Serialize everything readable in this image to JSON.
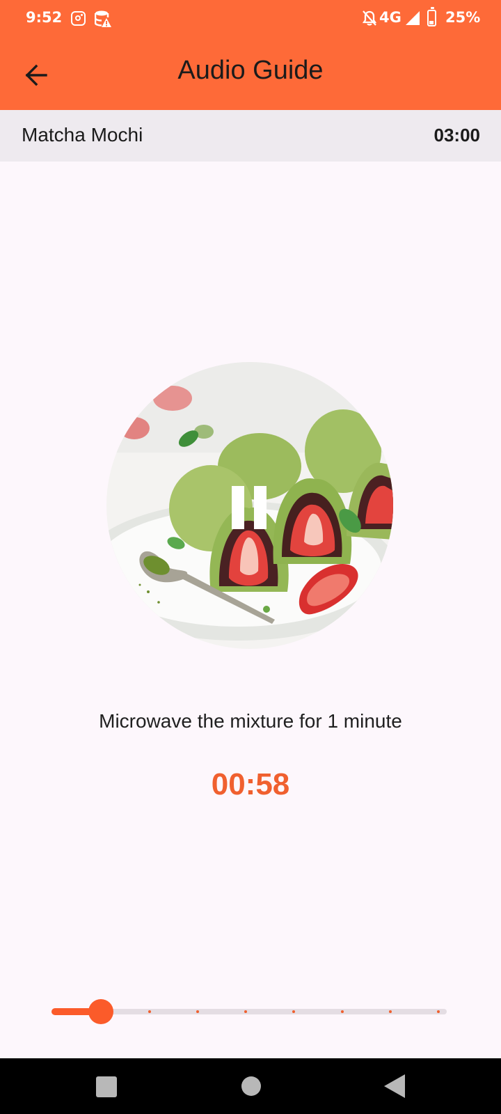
{
  "status_bar": {
    "time": "9:52",
    "network": "4G",
    "battery": "25%",
    "icons": [
      "instagram-icon",
      "database-warning-icon",
      "bell-off-icon",
      "signal-icon",
      "battery-icon"
    ]
  },
  "app_bar": {
    "title": "Audio Guide",
    "back_icon": "arrow-left-icon"
  },
  "recipe": {
    "name": "Matcha Mochi",
    "duration": "03:00"
  },
  "player": {
    "image_alt": "matcha mochi with strawberries",
    "state_icon": "pause-icon",
    "step_text": "Microwave the mixture for 1 minute",
    "step_timer": "00:58"
  },
  "progress": {
    "value": 1,
    "max": 8,
    "step_count": 9
  },
  "nav_bar": {
    "icons": [
      "recents-icon",
      "home-icon",
      "back-icon"
    ]
  },
  "colors": {
    "accent": "#fe6a38",
    "timer": "#f0602f",
    "background": "#fdf7fc",
    "header_strip": "#eeeaef"
  }
}
